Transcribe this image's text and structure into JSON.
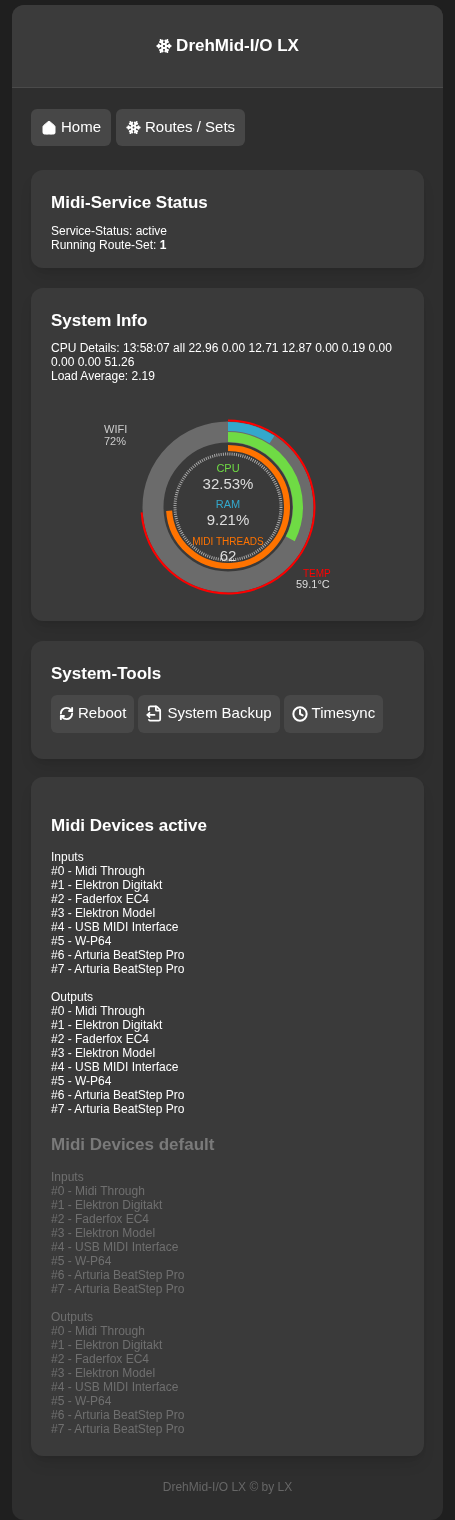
{
  "header": {
    "title": "DrehMid-I/O LX"
  },
  "nav": [
    {
      "label": "Home"
    },
    {
      "label": "Routes / Sets"
    }
  ],
  "status": {
    "title": "Midi-Service Status",
    "lines": [
      "Service-Status: active",
      "Running Route-Set: **1**"
    ]
  },
  "system_info": {
    "title": "System Info",
    "lines": [
      "CPU Details: 13:58:07 all 22.96 0.00 12.71 12.87 0.00 0.19 0.00 0.00 0.00 51.26",
      "Load Average: 2.19"
    ],
    "gauge": {
      "wifi": {
        "label": "WIFI",
        "value": "72%"
      },
      "temp": {
        "label": "TEMP",
        "value": "59.1°C"
      },
      "ram": {
        "label": "RAM",
        "value": "9.21%"
      },
      "cpu": {
        "label": "CPU",
        "value": "32.53%"
      },
      "threads": {
        "label": "MIDI THREADS",
        "value": "62"
      }
    }
  },
  "tools": {
    "title": "System-Tools",
    "buttons": [
      {
        "label": "Reboot"
      },
      {
        "label": "System Backup"
      },
      {
        "label": "Timesync"
      }
    ]
  },
  "devices": [
    {
      "title": "Midi Devices active",
      "disabled": false,
      "groups": [
        {
          "heading": "Inputs",
          "items": [
            "#0 - Midi Through",
            "#1 - Elektron Digitakt",
            "#2 - Faderfox EC4",
            "#3 - Elektron Model",
            "#4 - USB MIDI Interface",
            "#5 - W-P64",
            "#6 - Arturia BeatStep Pro",
            "#7 - Arturia BeatStep Pro"
          ]
        },
        {
          "heading": "Outputs",
          "items": [
            "#0 - Midi Through",
            "#1 - Elektron Digitakt",
            "#2 - Faderfox EC4",
            "#3 - Elektron Model",
            "#4 - USB MIDI Interface",
            "#5 - W-P64",
            "#6 - Arturia BeatStep Pro",
            "#7 - Arturia BeatStep Pro"
          ]
        }
      ]
    },
    {
      "title": "Midi Devices default",
      "disabled": true,
      "groups": [
        {
          "heading": "Inputs",
          "items": [
            "#0 - Midi Through",
            "#1 - Elektron Digitakt",
            "#2 - Faderfox EC4",
            "#3 - Elektron Model",
            "#4 - USB MIDI Interface",
            "#5 - W-P64",
            "#6 - Arturia BeatStep Pro",
            "#7 - Arturia BeatStep Pro"
          ]
        },
        {
          "heading": "Outputs",
          "items": [
            "#0 - Midi Through",
            "#1 - Elektron Digitakt",
            "#2 - Faderfox EC4",
            "#3 - Elektron Model",
            "#4 - USB MIDI Interface",
            "#5 - W-P64",
            "#6 - Arturia BeatStep Pro",
            "#7 - Arturia BeatStep Pro"
          ]
        }
      ]
    }
  ],
  "footer": "DrehMid-I/O LX © by LX"
}
